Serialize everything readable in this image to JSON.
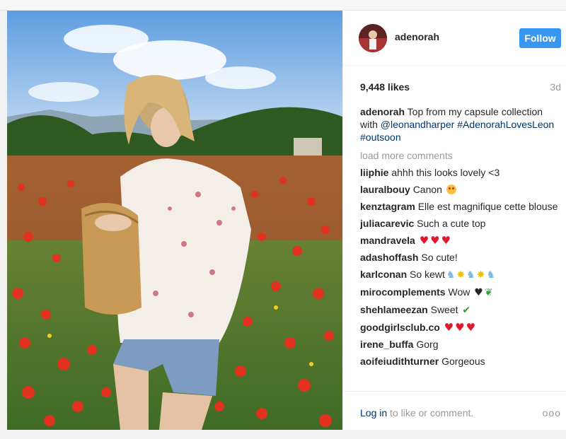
{
  "post": {
    "username": "adenorah",
    "follow_label": "Follow",
    "likes": "9,448 likes",
    "time_ago": "3d",
    "caption": {
      "text": "Top from my capsule collection with ",
      "mention": "@leonandharper",
      "hashtag1": "#AdenorahLovesLeon",
      "hashtag2": "#outsoon"
    },
    "load_more": "load more comments",
    "comments": [
      {
        "user": "liiphie",
        "text": "ahhh this looks lovely <3"
      },
      {
        "user": "lauralbouy",
        "text": "Canon"
      },
      {
        "user": "kenztagram",
        "text": "Elle est magnifique cette blouse"
      },
      {
        "user": "juliacarevic",
        "text": "Such a cute top"
      },
      {
        "user": "mandravela",
        "text": ""
      },
      {
        "user": "adashoffash",
        "text": "So cute!"
      },
      {
        "user": "karlconan",
        "text": "So kewt"
      },
      {
        "user": "mirocomplements",
        "text": "Wow"
      },
      {
        "user": "shehlameezan",
        "text": "Sweet"
      },
      {
        "user": "goodgirlsclub.co",
        "text": ""
      },
      {
        "user": "irene_buffa",
        "text": "Gorg"
      },
      {
        "user": "aoifeiudithturner",
        "text": "Gorgeous"
      }
    ],
    "login_link": "Log in",
    "login_text": " to like or comment.",
    "more_options": "ooo"
  },
  "icons": {
    "heart": "red-heart",
    "face": "heart-eyes-face",
    "unicorn": "unicorn-face",
    "sparkle": "collision-sparkle",
    "check": "green-check",
    "leaf": "green-herb"
  }
}
